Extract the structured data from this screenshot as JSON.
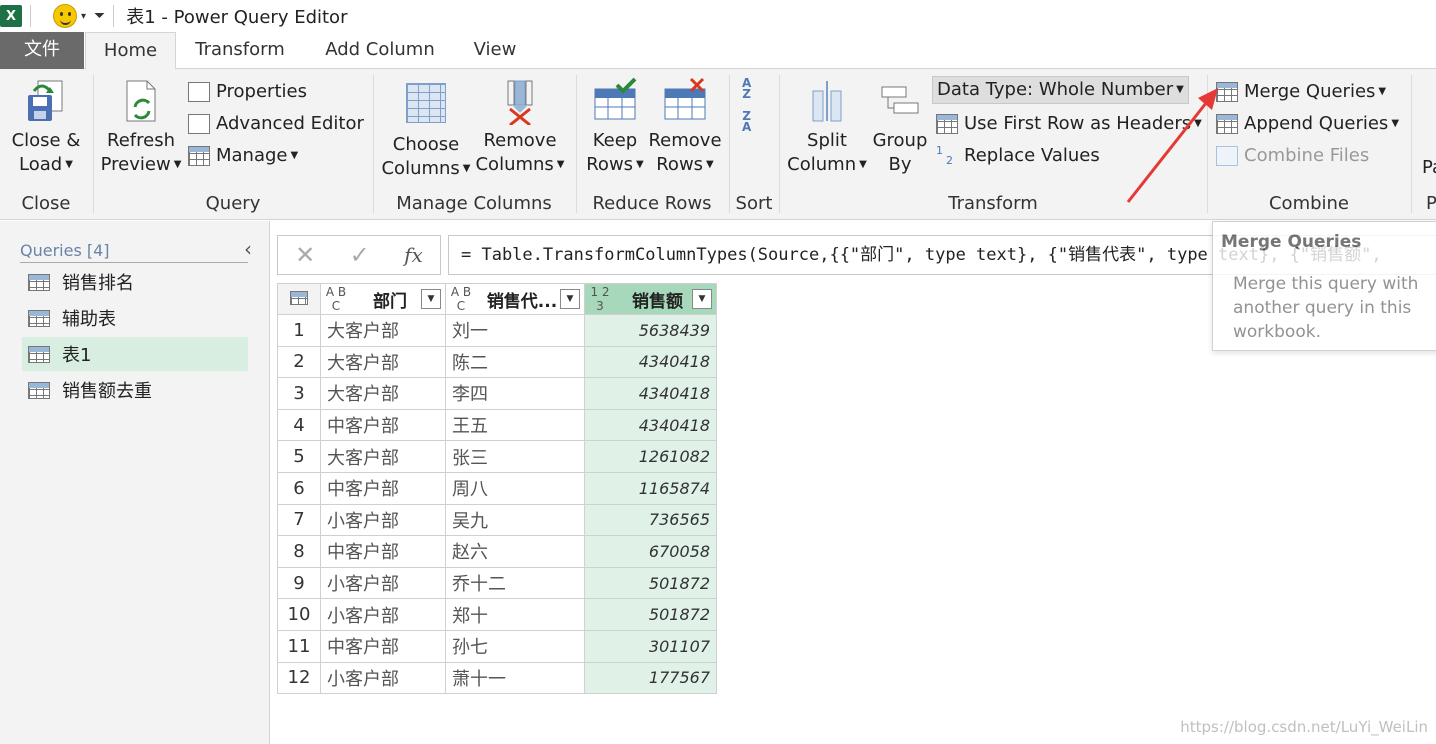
{
  "titlebar": {
    "app_icon": "X",
    "title": "表1 - Power Query Editor"
  },
  "tabs": {
    "file": "文件",
    "home": "Home",
    "transform": "Transform",
    "add_column": "Add Column",
    "view": "View"
  },
  "ribbon": {
    "close": {
      "btn1": "Close &",
      "btn2": "Load",
      "label": "Close"
    },
    "query": {
      "refresh1": "Refresh",
      "refresh2": "Preview",
      "properties": "Properties",
      "advanced": "Advanced Editor",
      "manage": "Manage",
      "label": "Query"
    },
    "manage_columns": {
      "choose1": "Choose",
      "choose2": "Columns",
      "remove1": "Remove",
      "remove2": "Columns",
      "label": "Manage Columns"
    },
    "reduce_rows": {
      "keep1": "Keep",
      "keep2": "Rows",
      "remove1": "Remove",
      "remove2": "Rows",
      "label": "Reduce Rows"
    },
    "sort": {
      "label": "Sort",
      "asc_top": "A",
      "asc_bottom": "Z",
      "desc_top": "Z",
      "desc_bottom": "A"
    },
    "transform": {
      "split1": "Split",
      "split2": "Column",
      "group1": "Group",
      "group2": "By",
      "data_type": "Data Type: Whole Number",
      "first_row": "Use First Row as Headers",
      "replace": "Replace Values",
      "replace_icon_top": "1",
      "replace_icon_bottom": "2",
      "label": "Transform"
    },
    "combine": {
      "merge": "Merge Queries",
      "append": "Append Queries",
      "combine_files": "Combine Files",
      "label": "Combine"
    },
    "cut_off": {
      "text": "Pa",
      "label": "P"
    }
  },
  "queries": {
    "header": "Queries [4]",
    "collapse_glyph": "‹",
    "items": [
      "销售排名",
      "辅助表",
      "表1",
      "销售额去重"
    ],
    "selected": "表1"
  },
  "formula_bar": {
    "cancel_glyph": "✕",
    "commit_glyph": "✓",
    "fx": "fx",
    "formula": "= Table.TransformColumnTypes(Source,{{\"部门\", type text}, {\"销售代表\", type text}, {\"销售额\","
  },
  "table": {
    "columns": [
      {
        "type_icon": "A B C",
        "name": "部门"
      },
      {
        "type_icon": "A B C",
        "name": "销售代..."
      },
      {
        "type_icon": "1 2 3",
        "name": "销售额"
      }
    ],
    "rows": [
      [
        "1",
        "大客户部",
        "刘一",
        "5638439"
      ],
      [
        "2",
        "大客户部",
        "陈二",
        "4340418"
      ],
      [
        "3",
        "大客户部",
        "李四",
        "4340418"
      ],
      [
        "4",
        "中客户部",
        "王五",
        "4340418"
      ],
      [
        "5",
        "大客户部",
        "张三",
        "1261082"
      ],
      [
        "6",
        "中客户部",
        "周八",
        "1165874"
      ],
      [
        "7",
        "小客户部",
        "吴九",
        "736565"
      ],
      [
        "8",
        "中客户部",
        "赵六",
        "670058"
      ],
      [
        "9",
        "小客户部",
        "乔十二",
        "501872"
      ],
      [
        "10",
        "小客户部",
        "郑十",
        "501872"
      ],
      [
        "11",
        "中客户部",
        "孙七",
        "301107"
      ],
      [
        "12",
        "小客户部",
        "萧十一",
        "177567"
      ]
    ]
  },
  "tooltip": {
    "title": "Merge Queries",
    "description": "Merge this query with another query in this workbook."
  },
  "watermark": "https://blog.csdn.net/LuYi_WeiLin",
  "colors": {
    "selected_query": "#d8eee1",
    "numeric_column": "#e0f2e8",
    "numeric_header": "#a7d8bb",
    "arrow": "#e53935",
    "file_tab": "#6a6a6a"
  }
}
